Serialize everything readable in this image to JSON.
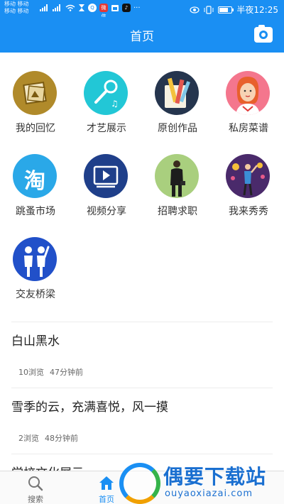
{
  "statusbar": {
    "carrier1": "移动 移动",
    "carrier2": "移动 移动",
    "app_label_red": "微信",
    "more": "···",
    "right_text": "半夜12:25",
    "battery_level": 0.75
  },
  "header": {
    "title": "首页"
  },
  "grid": [
    {
      "label": "我的回忆",
      "icon": "photo-frame-icon"
    },
    {
      "label": "才艺展示",
      "icon": "microphone-icon"
    },
    {
      "label": "原创作品",
      "icon": "pencils-icon"
    },
    {
      "label": "私房菜谱",
      "icon": "chef-woman-icon"
    },
    {
      "label": "跳蚤市场",
      "icon": "taobao-icon",
      "glyph": "淘"
    },
    {
      "label": "视频分享",
      "icon": "video-play-icon"
    },
    {
      "label": "招聘求职",
      "icon": "businessman-icon"
    },
    {
      "label": "我来秀秀",
      "icon": "performer-icon"
    },
    {
      "label": "交友桥梁",
      "icon": "friends-icon"
    }
  ],
  "feed": [
    {
      "title": "白山黑水",
      "views": "10浏览",
      "time": "47分钟前"
    },
    {
      "title": "雪季的云，充满喜悦，风一摸",
      "views": "2浏览",
      "time": "48分钟前"
    },
    {
      "title": "学校文化展示",
      "views": "",
      "time": ""
    }
  ],
  "bottomnav": [
    {
      "label": "搜索",
      "icon": "search-icon",
      "active": false
    },
    {
      "label": "首页",
      "icon": "home-icon",
      "active": true
    }
  ],
  "watermark": {
    "title": "偶要下载站",
    "url": "ouyaoxiazai.com"
  },
  "colors": {
    "primary": "#1a8ff3"
  }
}
